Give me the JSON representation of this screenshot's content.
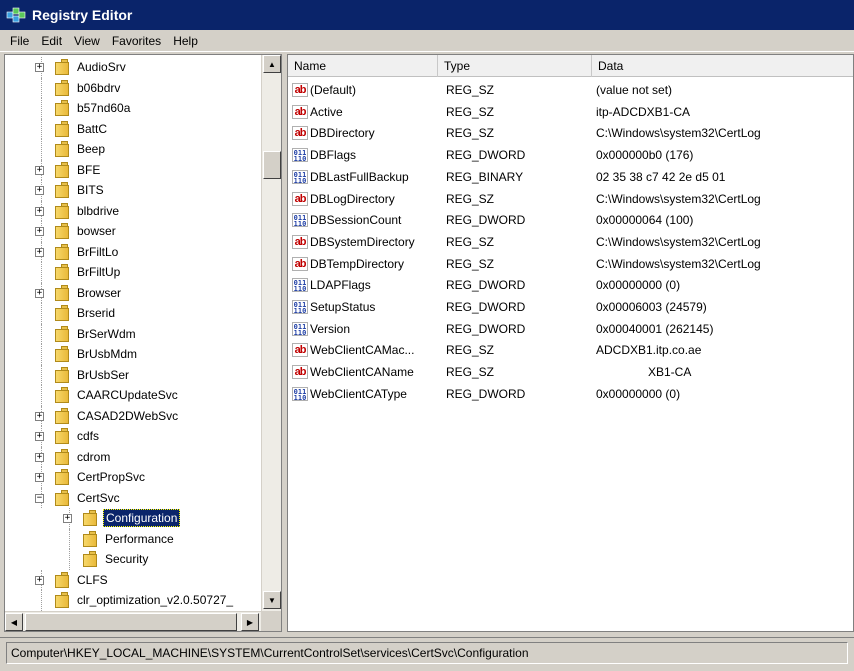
{
  "window": {
    "title": "Registry Editor"
  },
  "menu": [
    "File",
    "Edit",
    "View",
    "Favorites",
    "Help"
  ],
  "tree": [
    {
      "label": "AudioSrv",
      "expandable": true
    },
    {
      "label": "b06bdrv",
      "expandable": false
    },
    {
      "label": "b57nd60a",
      "expandable": false
    },
    {
      "label": "BattC",
      "expandable": false
    },
    {
      "label": "Beep",
      "expandable": false
    },
    {
      "label": "BFE",
      "expandable": true
    },
    {
      "label": "BITS",
      "expandable": true
    },
    {
      "label": "blbdrive",
      "expandable": true
    },
    {
      "label": "bowser",
      "expandable": true
    },
    {
      "label": "BrFiltLo",
      "expandable": true
    },
    {
      "label": "BrFiltUp",
      "expandable": false
    },
    {
      "label": "Browser",
      "expandable": true
    },
    {
      "label": "Brserid",
      "expandable": false
    },
    {
      "label": "BrSerWdm",
      "expandable": false
    },
    {
      "label": "BrUsbMdm",
      "expandable": false
    },
    {
      "label": "BrUsbSer",
      "expandable": false
    },
    {
      "label": "CAARCUpdateSvc",
      "expandable": false
    },
    {
      "label": "CASAD2DWebSvc",
      "expandable": true
    },
    {
      "label": "cdfs",
      "expandable": true
    },
    {
      "label": "cdrom",
      "expandable": true
    },
    {
      "label": "CertPropSvc",
      "expandable": true
    },
    {
      "label": "CertSvc",
      "expandable": true,
      "expanded": true
    },
    {
      "label": "Configuration",
      "expandable": true,
      "level": 1,
      "selected": true
    },
    {
      "label": "Performance",
      "expandable": false,
      "level": 1
    },
    {
      "label": "Security",
      "expandable": false,
      "level": 1
    },
    {
      "label": "CLFS",
      "expandable": true
    },
    {
      "label": "clr_optimization_v2.0.50727_",
      "expandable": false
    }
  ],
  "columns": {
    "name": "Name",
    "type": "Type",
    "data": "Data"
  },
  "values": [
    {
      "icon": "ab",
      "name": "(Default)",
      "type": "REG_SZ",
      "data": "(value not set)"
    },
    {
      "icon": "ab",
      "name": "Active",
      "type": "REG_SZ",
      "data": "itp-ADCDXB1-CA"
    },
    {
      "icon": "ab",
      "name": "DBDirectory",
      "type": "REG_SZ",
      "data": "C:\\Windows\\system32\\CertLog"
    },
    {
      "icon": "bin",
      "name": "DBFlags",
      "type": "REG_DWORD",
      "data": "0x000000b0 (176)"
    },
    {
      "icon": "bin",
      "name": "DBLastFullBackup",
      "type": "REG_BINARY",
      "data": "02 35 38 c7 42 2e d5 01"
    },
    {
      "icon": "ab",
      "name": "DBLogDirectory",
      "type": "REG_SZ",
      "data": "C:\\Windows\\system32\\CertLog"
    },
    {
      "icon": "bin",
      "name": "DBSessionCount",
      "type": "REG_DWORD",
      "data": "0x00000064 (100)"
    },
    {
      "icon": "ab",
      "name": "DBSystemDirectory",
      "type": "REG_SZ",
      "data": "C:\\Windows\\system32\\CertLog"
    },
    {
      "icon": "ab",
      "name": "DBTempDirectory",
      "type": "REG_SZ",
      "data": "C:\\Windows\\system32\\CertLog"
    },
    {
      "icon": "bin",
      "name": "LDAPFlags",
      "type": "REG_DWORD",
      "data": "0x00000000 (0)"
    },
    {
      "icon": "bin",
      "name": "SetupStatus",
      "type": "REG_DWORD",
      "data": "0x00006003 (24579)"
    },
    {
      "icon": "bin",
      "name": "Version",
      "type": "REG_DWORD",
      "data": "0x00040001 (262145)"
    },
    {
      "icon": "ab",
      "name": "WebClientCAMac...",
      "type": "REG_SZ",
      "data": "ADCDXB1.itp.co.ae"
    },
    {
      "icon": "ab",
      "name": "WebClientCAName",
      "type": "REG_SZ",
      "data": "XB1-CA",
      "redacted": true
    },
    {
      "icon": "bin",
      "name": "WebClientCAType",
      "type": "REG_DWORD",
      "data": "0x00000000 (0)"
    }
  ],
  "status": "Computer\\HKEY_LOCAL_MACHINE\\SYSTEM\\CurrentControlSet\\services\\CertSvc\\Configuration"
}
